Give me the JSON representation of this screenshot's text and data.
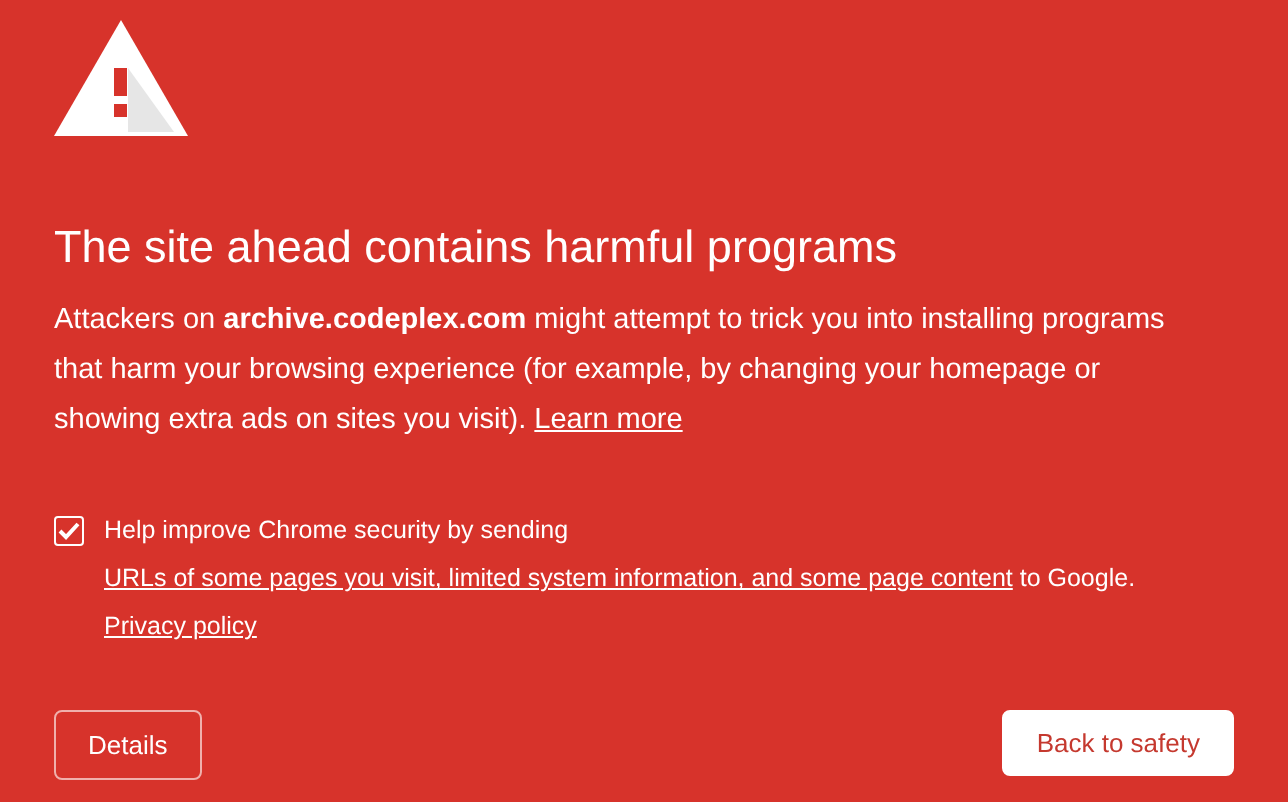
{
  "title": "The site ahead contains harmful programs",
  "message": [
    {
      "kind": "text",
      "text": "Attackers on **archive.codeplex.com** might attempt to trick you into installing programs that harm your browsing experience (for example, by changing your homepage or showing extra ads on sites you visit). "
    },
    {
      "kind": "link",
      "text": "Learn more"
    }
  ],
  "opt_in": {
    "checked": true,
    "parts": [
      {
        "kind": "text",
        "text": "Help improve Chrome security by sending "
      },
      {
        "kind": "link",
        "text": "URLs of some pages you visit, limited system information, and some page content"
      },
      {
        "kind": "text",
        "text": " to Google. "
      },
      {
        "kind": "link",
        "text": "Privacy policy"
      }
    ]
  },
  "buttons": [
    {
      "label": "Details",
      "kind": "secondary"
    },
    {
      "label": "Back to safety",
      "kind": "primary"
    }
  ]
}
